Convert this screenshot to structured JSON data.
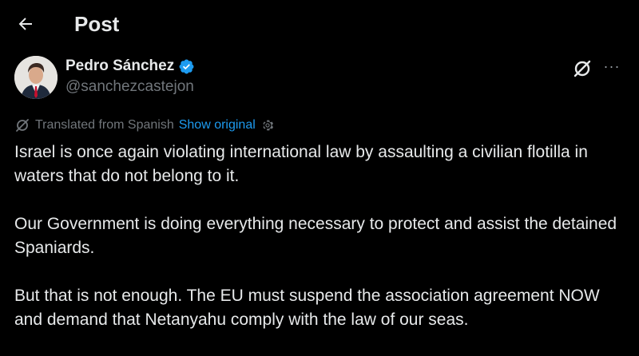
{
  "header": {
    "back_icon": "arrow-left-icon",
    "title": "Post"
  },
  "author": {
    "name": "Pedro Sánchez",
    "handle": "@sanchezcastejon",
    "verified_icon": "verified-badge-icon",
    "verified_color": "#1d9bf0"
  },
  "actions": {
    "grok_icon": "grok-icon",
    "more_icon": "more-horizontal-icon",
    "more_label": "···"
  },
  "translation": {
    "icon": "translate-icon",
    "label": "Translated from Spanish",
    "show_original": "Show original",
    "settings_icon": "gear-icon"
  },
  "tweet": {
    "paragraphs": [
      "Israel is once again violating international law by assaulting a civilian flotilla in waters that do not belong to it.",
      "Our Government is doing everything necessary to protect and assist the detained Spaniards.",
      "But that is not enough. The EU must suspend the association agreement NOW and demand that Netanyahu comply with the law of our seas."
    ]
  },
  "colors": {
    "background": "#000000",
    "text_primary": "#e7e9ea",
    "text_secondary": "#71767b",
    "link": "#1d9bf0"
  }
}
